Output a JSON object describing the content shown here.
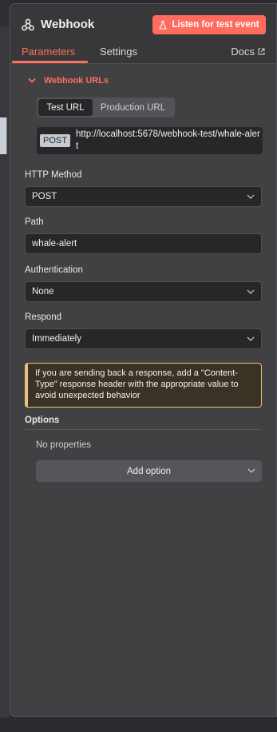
{
  "node": {
    "title": "Webhook",
    "icon": "webhook-icon",
    "listen_button": "Listen for test event"
  },
  "tabs": {
    "parameters": "Parameters",
    "settings": "Settings",
    "docs": "Docs"
  },
  "webhook_urls": {
    "heading": "Webhook URLs",
    "test_tab": "Test URL",
    "production_tab": "Production URL",
    "method": "POST",
    "url": "http://localhost:5678/webhook-test/whale-alert"
  },
  "fields": {
    "http_method": {
      "label": "HTTP Method",
      "value": "POST"
    },
    "path": {
      "label": "Path",
      "value": "whale-alert"
    },
    "authentication": {
      "label": "Authentication",
      "value": "None"
    },
    "respond": {
      "label": "Respond",
      "value": "Immediately"
    }
  },
  "notice": "If you are sending back a response, add a \"Content-Type\" response header with the appropriate value to avoid unexpected behavior",
  "options": {
    "label": "Options",
    "empty_text": "No properties",
    "add_button": "Add option"
  },
  "colors": {
    "accent": "#ff6f5e",
    "panel": "#414144",
    "input_bg": "#27272a",
    "warning_border": "#e8c27d"
  }
}
